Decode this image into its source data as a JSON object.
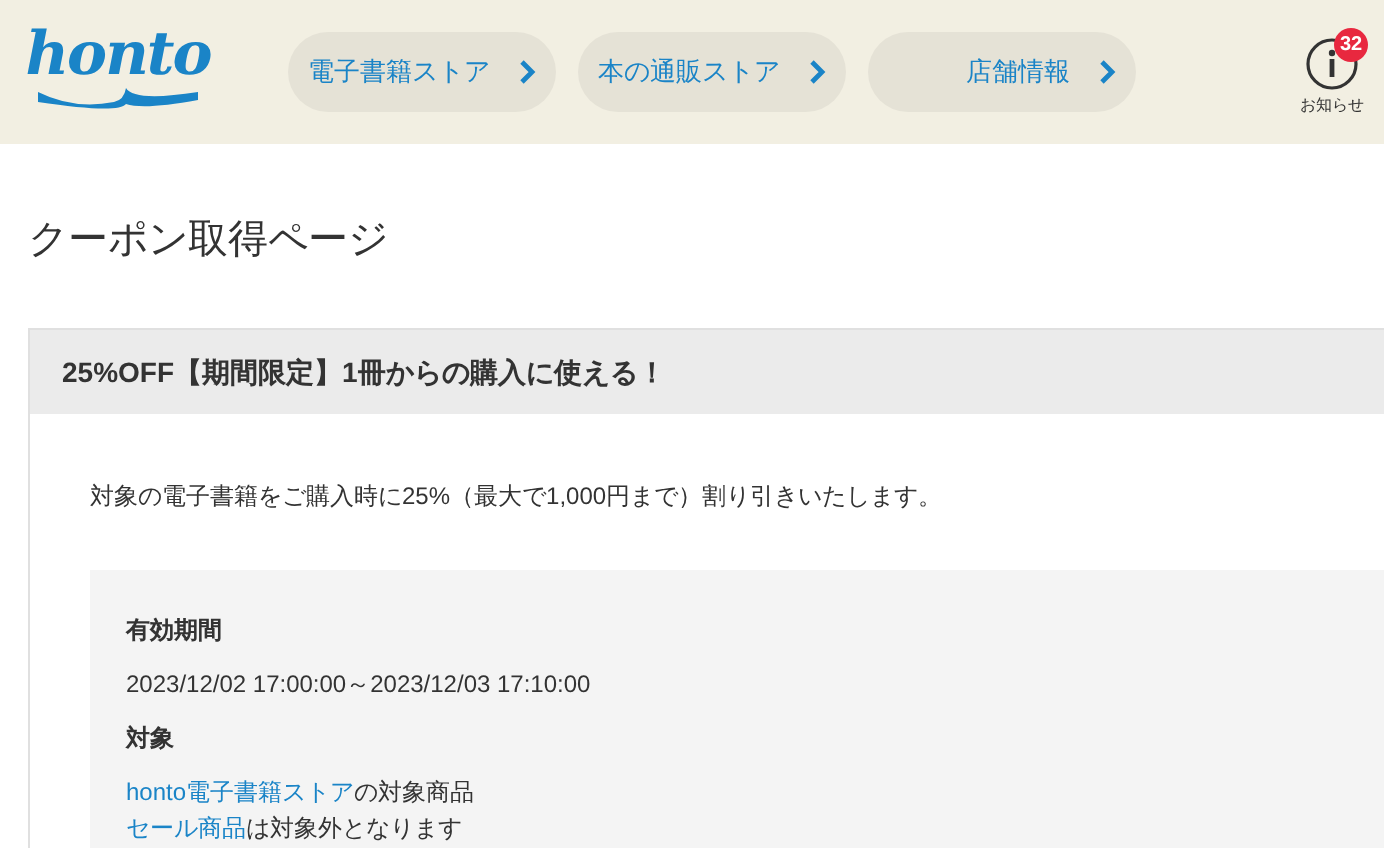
{
  "header": {
    "logo": "honto",
    "nav": [
      {
        "label": "電子書籍ストア"
      },
      {
        "label": "本の通販ストア"
      },
      {
        "label": "店舗情報"
      }
    ],
    "notice": {
      "label": "お知らせ",
      "badge": "32"
    }
  },
  "page_title": "クーポン取得ページ",
  "coupon": {
    "title": "25%OFF【期間限定】1冊からの購入に使える！",
    "description": "対象の電子書籍をご購入時に25%（最大で1,000円まで）割り引きいたします。",
    "details": [
      {
        "heading": "有効期間",
        "lines": [
          {
            "text": "2023/12/02 17:00:00～2023/12/03 17:10:00"
          }
        ]
      },
      {
        "heading": "対象",
        "lines": [
          {
            "link": "honto電子書籍ストア",
            "text": "の対象商品"
          },
          {
            "link": "セール商品",
            "text": "は対象外となります"
          }
        ]
      }
    ]
  }
}
